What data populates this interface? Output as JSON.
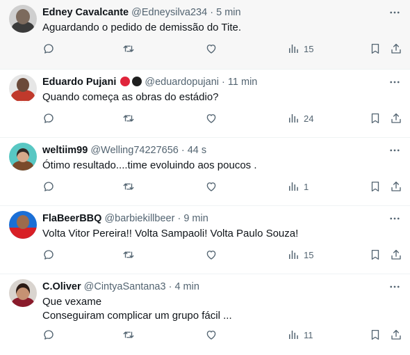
{
  "tweets": [
    {
      "name": "Edney Cavalcante",
      "handle": "@Edneysilva234",
      "dot": "·",
      "time": "5 min",
      "lines": [
        "Aguardando o pedido de demissão do Tite."
      ],
      "views": "15"
    },
    {
      "name": "Eduardo Pujani",
      "badges": [
        "red-circle",
        "black-circle"
      ],
      "handle": "@eduardopujani",
      "dot": "·",
      "time": "11 min",
      "lines": [
        "Quando começa as obras do estádio?"
      ],
      "views": "24"
    },
    {
      "name": "weltiim99",
      "handle": "@Welling74227656",
      "dot": "·",
      "time": "44 s",
      "lines": [
        "Ótimo resultado....time evoluindo aos poucos ."
      ],
      "views": "1"
    },
    {
      "name": "FlaBeerBBQ",
      "handle": "@barbiekillbeer",
      "dot": "·",
      "time": "9 min",
      "lines": [
        "Volta Vitor Pereira!! Volta Sampaoli! Volta Paulo Souza!"
      ],
      "views": "15"
    },
    {
      "name": "C.Oliver",
      "handle": "@CintyaSantana3",
      "dot": "·",
      "time": "4 min",
      "lines": [
        "Que vexame",
        "Conseguiram complicar um grupo fácil ..."
      ],
      "views": "11"
    }
  ],
  "icons": {
    "more": "more-horizontal-icon",
    "reply": "reply-icon",
    "retweet": "retweet-icon",
    "like": "like-heart-icon",
    "views": "views-bar-chart-icon",
    "bookmark": "bookmark-icon",
    "share": "share-icon"
  },
  "colors": {
    "text": "#0f1419",
    "muted": "#536471",
    "divider": "#eff3f4",
    "highlight_bg": "#f7f7f7",
    "badge_red": "#e0243b",
    "badge_black": "#1f1f1f"
  }
}
